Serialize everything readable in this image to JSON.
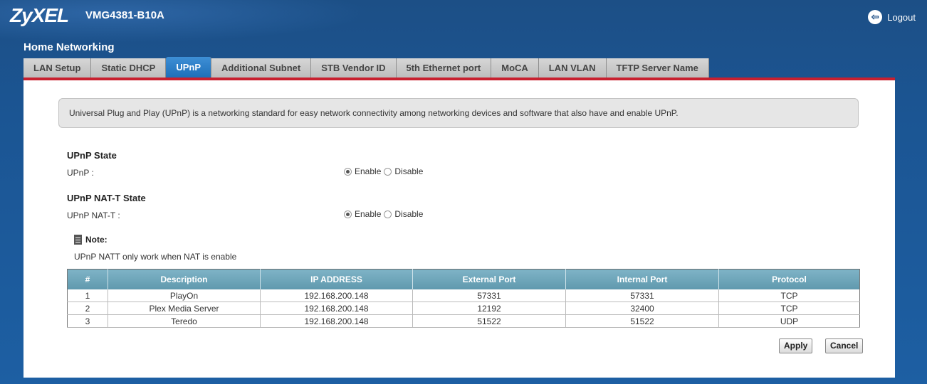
{
  "header": {
    "logo": "ZyXEL",
    "model": "VMG4381-B10A",
    "logout_label": "Logout",
    "logout_icon": "logout-icon"
  },
  "section_title": "Home Networking",
  "tabs": [
    {
      "label": "LAN Setup",
      "active": false
    },
    {
      "label": "Static DHCP",
      "active": false
    },
    {
      "label": "UPnP",
      "active": true
    },
    {
      "label": "Additional Subnet",
      "active": false
    },
    {
      "label": "STB Vendor ID",
      "active": false
    },
    {
      "label": "5th Ethernet port",
      "active": false
    },
    {
      "label": "MoCA",
      "active": false
    },
    {
      "label": "LAN VLAN",
      "active": false
    },
    {
      "label": "TFTP Server Name",
      "active": false
    }
  ],
  "info_text": "Universal Plug and Play (UPnP) is a networking standard for easy network connectivity among networking devices and software that also have and enable UPnP.",
  "upnp_state": {
    "title": "UPnP State",
    "label": "UPnP :",
    "enable_label": "Enable",
    "disable_label": "Disable",
    "selected": "Enable"
  },
  "natt_state": {
    "title": "UPnP NAT-T State",
    "label": "UPnP NAT-T :",
    "enable_label": "Enable",
    "disable_label": "Disable",
    "selected": "Enable"
  },
  "note": {
    "title": "Note:",
    "text": "UPnP NATT only work when NAT is enable",
    "icon": "note-icon"
  },
  "table": {
    "headers": [
      "#",
      "Description",
      "IP ADDRESS",
      "External Port",
      "Internal Port",
      "Protocol"
    ],
    "rows": [
      [
        "1",
        "PlayOn",
        "192.168.200.148",
        "57331",
        "57331",
        "TCP"
      ],
      [
        "2",
        "Plex Media Server",
        "192.168.200.148",
        "12192",
        "32400",
        "TCP"
      ],
      [
        "3",
        "Teredo",
        "192.168.200.148",
        "51522",
        "51522",
        "UDP"
      ]
    ]
  },
  "buttons": {
    "apply": "Apply",
    "cancel": "Cancel"
  },
  "colors": {
    "background": "#1c4f86",
    "tab_active": "#2a7ec8",
    "panel_accent": "#c8202f",
    "table_header": "#6ea6ba"
  }
}
